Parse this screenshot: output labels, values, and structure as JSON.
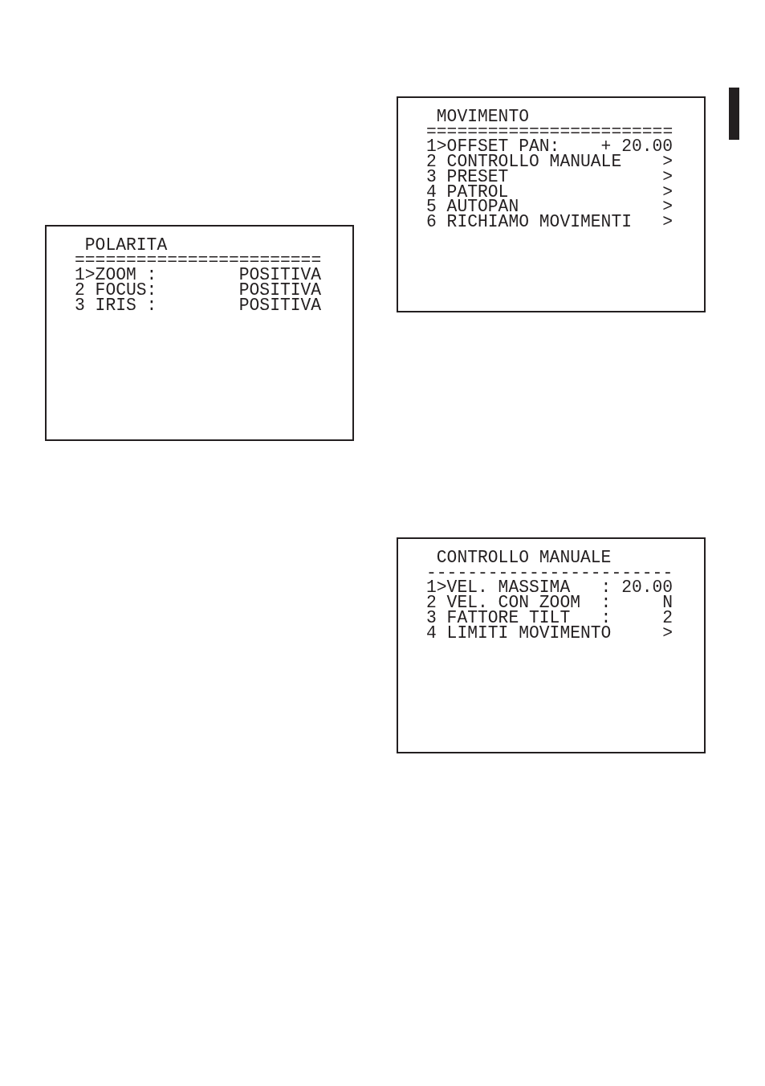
{
  "screens": [
    {
      "title": "POLARITA",
      "separator": "========================",
      "items": [
        {
          "label": "1>ZOOM :",
          "value": "POSITIVA"
        },
        {
          "label": "2 FOCUS:",
          "value": "POSITIVA"
        },
        {
          "label": "3 IRIS :",
          "value": "POSITIVA"
        }
      ]
    },
    {
      "title": "MOVIMENTO",
      "separator": "========================",
      "items": [
        {
          "label": "1>OFFSET PAN:",
          "value": "+ 20.00"
        },
        {
          "label": "2 CONTROLLO MANUALE",
          "value": ">"
        },
        {
          "label": "3 PRESET",
          "value": ">"
        },
        {
          "label": "4 PATROL",
          "value": ">"
        },
        {
          "label": "5 AUTOPAN",
          "value": ">"
        },
        {
          "label": "6 RICHIAMO MOVIMENTI",
          "value": ">"
        }
      ]
    },
    {
      "title": "CONTROLLO MANUALE",
      "separator": "------------------------",
      "items": [
        {
          "label": "1>VEL. MASSIMA   :",
          "value": "20.00"
        },
        {
          "label": "2 VEL. CON ZOOM  :",
          "value": "N"
        },
        {
          "label": "3 FATTORE TILT   :",
          "value": "2"
        },
        {
          "label": "4 LIMITI MOVIMENTO",
          "value": ">"
        }
      ]
    }
  ]
}
